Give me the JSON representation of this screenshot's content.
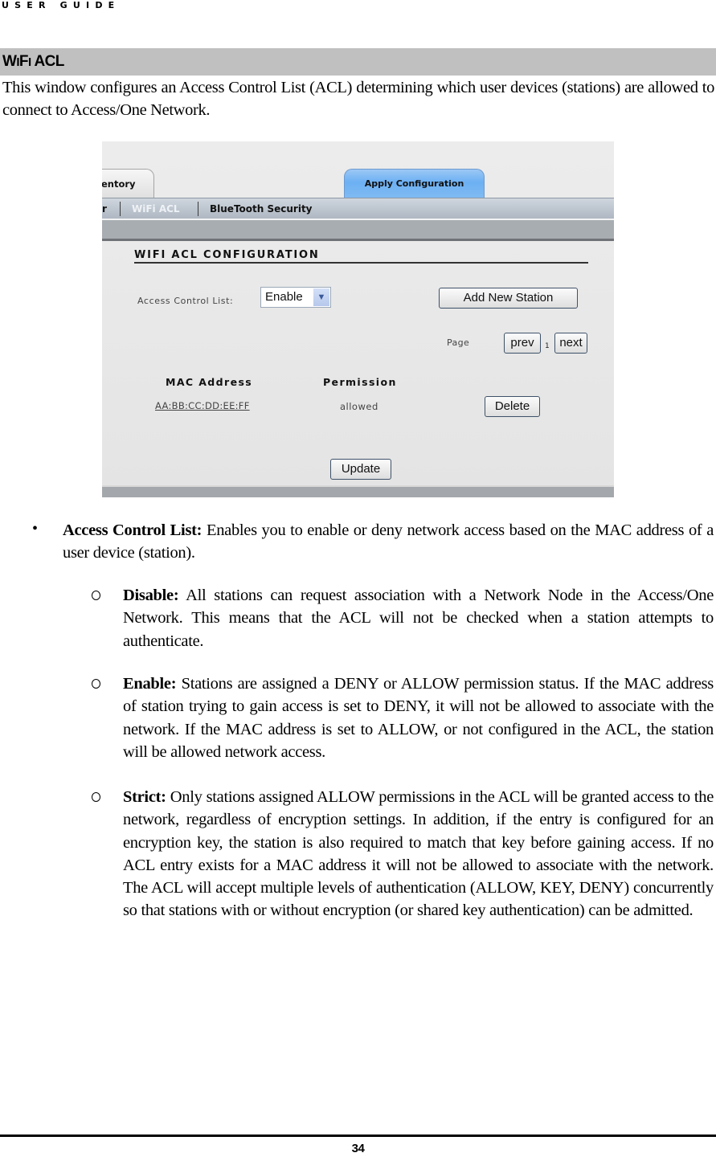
{
  "header": {
    "running_title": "USER GUIDE"
  },
  "section": {
    "title_parts": [
      "W",
      "I",
      "F",
      "I",
      " ACL"
    ],
    "intro": "This window configures an Access Control List (ACL) determining which user devices (stations) are allowed to connect to Access/One Network."
  },
  "screenshot": {
    "tabs": [
      {
        "label": "entory",
        "active": false
      },
      {
        "label": "Apply Configuration",
        "active": true
      }
    ],
    "subnav": [
      {
        "label": "r",
        "active": false
      },
      {
        "label": "WiFi ACL",
        "active": true
      },
      {
        "label": "BlueTooth Security",
        "active": false
      }
    ],
    "colors": {
      "active_tab": "#6cb0f3",
      "active_subnav_text": "#eef2f6",
      "subnav_text": "#111111"
    },
    "config_title": "WIFI ACL CONFIGURATION",
    "acl_label": "Access Control List:",
    "acl_select": {
      "value": "Enable",
      "arrow_icon": "chevron-down"
    },
    "add_station_button": "Add New Station",
    "pagination": {
      "label": "Page",
      "prev": "prev",
      "current": "1",
      "next": "next"
    },
    "table": {
      "columns": [
        "MAC Address",
        "Permission"
      ],
      "rows": [
        {
          "mac": "AA:BB:CC:DD:EE:FF",
          "permission": "allowed",
          "action": "Delete"
        }
      ]
    },
    "update_button": "Update"
  },
  "bullets": [
    {
      "term": "Access Control List:",
      "text": " Enables you to enable or deny network access based on the MAC address of a user device (station).",
      "sub": [
        {
          "term": "Disable:",
          "text": " All stations can request association with a Network Node in the Access/One Network. This means that the ACL will not be checked when a station attempts to authenticate."
        },
        {
          "term": "Enable:",
          "text": " Stations are assigned a DENY or ALLOW permission status. If the MAC address of station trying to gain access is set to DENY, it will not be allowed to associate with the network. If the MAC address is set to ALLOW, or not configured in the ACL, the station will be allowed network access."
        },
        {
          "term": "Strict:",
          "text": " Only stations assigned ALLOW permissions in the ACL will be granted access to the network, regardless of encryption settings. In addition, if the entry is configured for an encryption key, the station is also required to match that key before gaining access. If no ACL entry exists for a MAC address it will not be allowed to associate with the network. The ACL will accept multiple levels of authentication (ALLOW, KEY, DENY) concurrently so that stations with or without encryption (or shared key authentication) can be admitted."
        }
      ]
    }
  ],
  "footer": {
    "page_number": "34"
  }
}
